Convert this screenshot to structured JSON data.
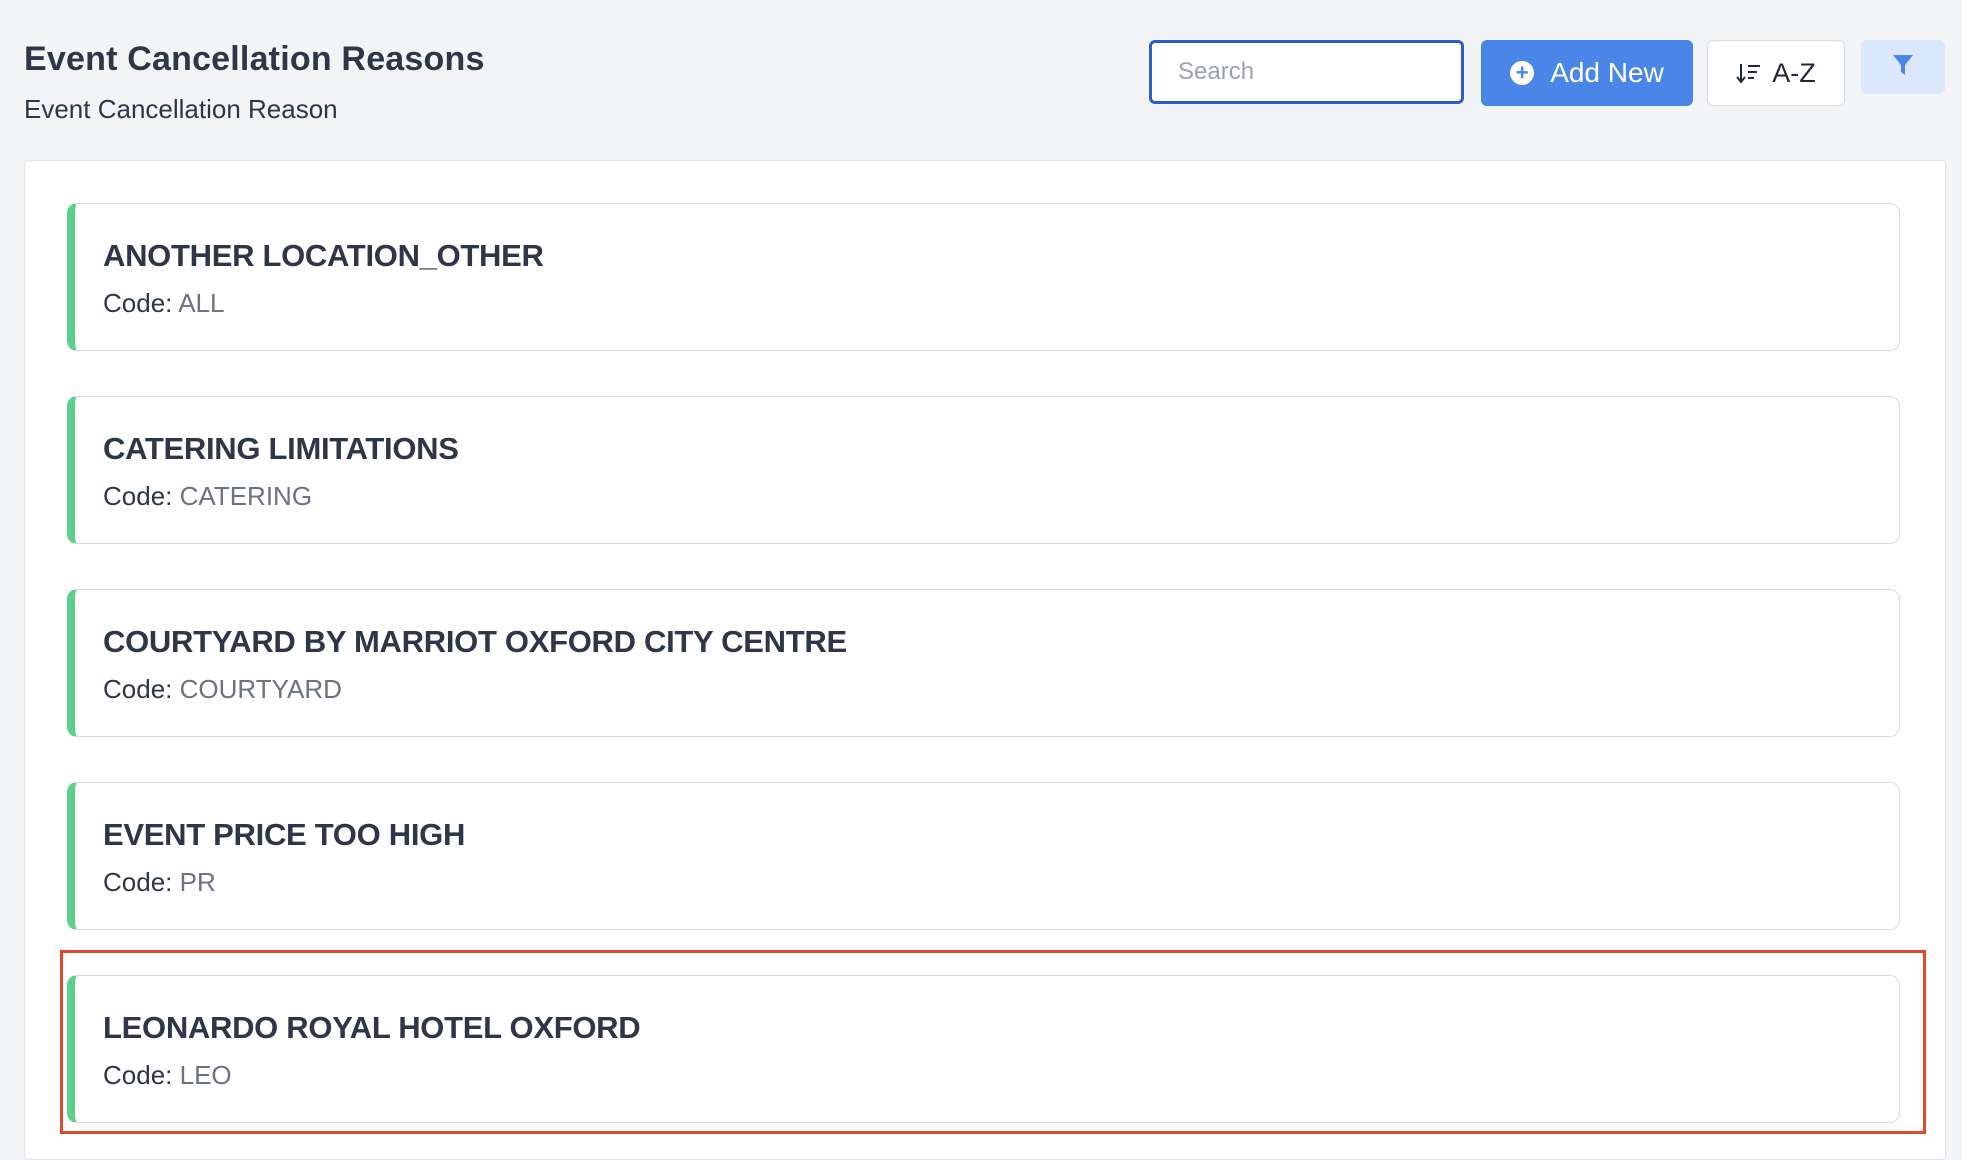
{
  "header": {
    "title": "Event Cancellation Reasons",
    "subtitle": "Event Cancellation Reason"
  },
  "toolbar": {
    "search_placeholder": "Search",
    "search_value": "",
    "add_label": "Add New",
    "sort_label": "A-Z",
    "accent_color": "#4a86e8"
  },
  "list": {
    "code_label": "Code:",
    "accent_color": "#5ccf8a",
    "items": [
      {
        "name": "ANOTHER LOCATION_OTHER",
        "code": "ALL"
      },
      {
        "name": "CATERING LIMITATIONS",
        "code": "CATERING"
      },
      {
        "name": "COURTYARD BY MARRIOT OXFORD CITY CENTRE",
        "code": "COURTYARD"
      },
      {
        "name": "EVENT PRICE TOO HIGH",
        "code": "PR"
      },
      {
        "name": "LEONARDO ROYAL HOTEL OXFORD",
        "code": "LEO"
      }
    ]
  },
  "highlight": {
    "color": "#e04a2b",
    "target": "LEONARDO ROYAL HOTEL OXFORD"
  }
}
